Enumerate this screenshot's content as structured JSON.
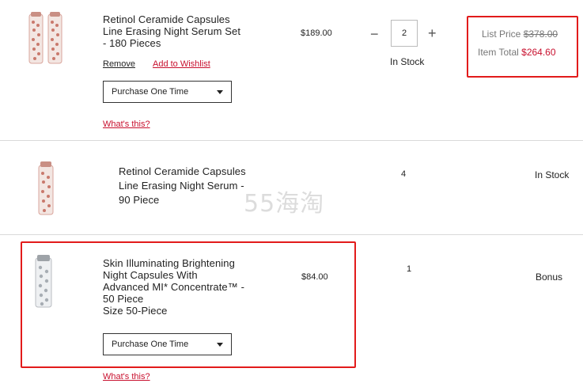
{
  "items": [
    {
      "title_lines": [
        "Retinol Ceramide Capsules",
        "Line Erasing Night Serum Set",
        "- 180 Pieces"
      ],
      "price": "$189.00",
      "qty": "2",
      "stock": "In Stock",
      "remove_label": "Remove",
      "wishlist_label": "Add to Wishlist",
      "purchase_option": "Purchase One Time",
      "whats_this": "What's this?",
      "list_price_label": "List Price",
      "list_price": "$378.00",
      "item_total_label": "Item Total",
      "item_total": "$264.60"
    },
    {
      "title_lines": [
        "Retinol Ceramide Capsules",
        "Line Erasing Night Serum -",
        "90 Piece"
      ],
      "qty": "4",
      "stock": "In Stock"
    },
    {
      "title_lines": [
        "Skin Illuminating Brightening",
        "Night Capsules With",
        "Advanced MI* Concentrate™ -",
        "50 Piece"
      ],
      "size": "Size 50-Piece",
      "price": "$84.00",
      "qty": "1",
      "status": "Bonus",
      "purchase_option": "Purchase One Time",
      "whats_this": "What's this?"
    }
  ],
  "watermark": "55海淘",
  "icons": {
    "minus": "minus-icon",
    "plus": "plus-icon",
    "caret": "chevron-down-icon"
  },
  "colors": {
    "accent_red": "#c8102e",
    "highlight_box": "#e21b1b",
    "bottle_pink": "#d9a59c",
    "bottle_silver": "#b9bcc1"
  }
}
